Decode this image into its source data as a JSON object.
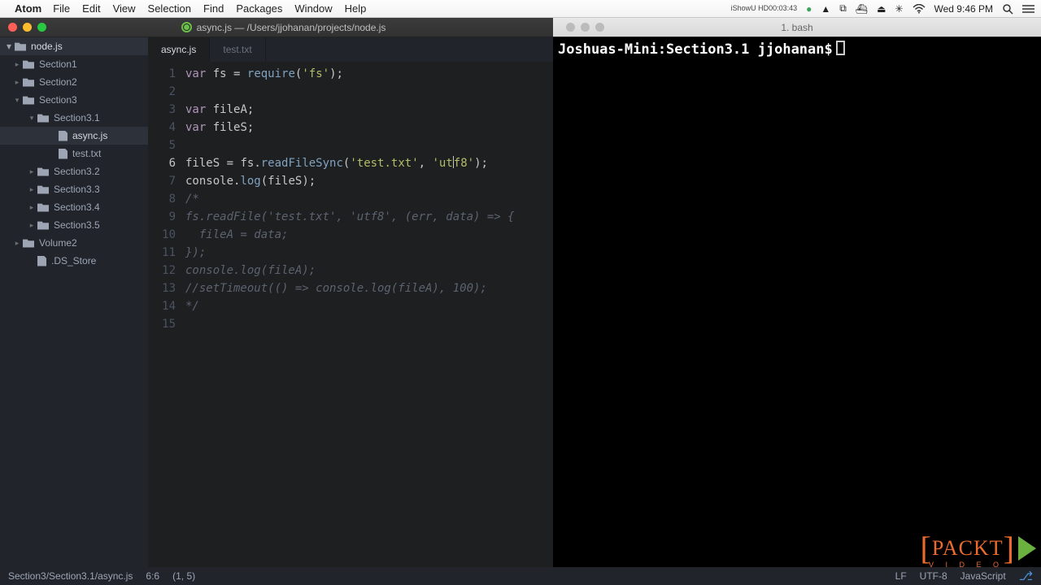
{
  "menubar": {
    "app": "Atom",
    "items": [
      "File",
      "Edit",
      "View",
      "Selection",
      "Find",
      "Packages",
      "Window",
      "Help"
    ],
    "right": {
      "ishow_top": "iShowU HD",
      "ishow_bot": "00:03:43",
      "clock": "Wed 9:46 PM"
    }
  },
  "window": {
    "atom_title": "async.js — /Users/jjohanan/projects/node.js",
    "term_title": "1. bash"
  },
  "sidebar": {
    "root": "node.js",
    "items": [
      {
        "indent": 16,
        "chev": "▸",
        "icon": "folder",
        "label": "Section1"
      },
      {
        "indent": 16,
        "chev": "▸",
        "icon": "folder",
        "label": "Section2"
      },
      {
        "indent": 16,
        "chev": "▾",
        "icon": "folder",
        "label": "Section3"
      },
      {
        "indent": 34,
        "chev": "▾",
        "icon": "folder",
        "label": "Section3.1"
      },
      {
        "indent": 60,
        "chev": "",
        "icon": "file",
        "label": "async.js",
        "selected": true
      },
      {
        "indent": 60,
        "chev": "",
        "icon": "file",
        "label": "test.txt"
      },
      {
        "indent": 34,
        "chev": "▸",
        "icon": "folder",
        "label": "Section3.2"
      },
      {
        "indent": 34,
        "chev": "▸",
        "icon": "folder",
        "label": "Section3.3"
      },
      {
        "indent": 34,
        "chev": "▸",
        "icon": "folder",
        "label": "Section3.4"
      },
      {
        "indent": 34,
        "chev": "▸",
        "icon": "folder",
        "label": "Section3.5"
      },
      {
        "indent": 16,
        "chev": "▸",
        "icon": "folder",
        "label": "Volume2"
      },
      {
        "indent": 34,
        "chev": "",
        "icon": "file",
        "label": ".DS_Store"
      }
    ]
  },
  "tabs": [
    {
      "label": "async.js",
      "active": true
    },
    {
      "label": "test.txt",
      "active": false
    }
  ],
  "code": {
    "lines": [
      {
        "n": 1,
        "html": "<span class='kw'>var</span> <span class='id'>fs</span> = <span class='fn'>require</span>(<span class='str'>'fs'</span>);"
      },
      {
        "n": 2,
        "html": ""
      },
      {
        "n": 3,
        "html": "<span class='kw'>var</span> <span class='id'>fileA</span>;"
      },
      {
        "n": 4,
        "html": "<span class='kw'>var</span> <span class='id'>fileS</span>;"
      },
      {
        "n": 5,
        "html": ""
      },
      {
        "n": 6,
        "html": "<span class='id'>fileS</span> = <span class='obj'>fs</span>.<span class='fn'>readFileSync</span>(<span class='str'>'test.txt'</span>, <span class='str'>'ut<span class=\"caret\"></span>f8'</span>);",
        "hl": true
      },
      {
        "n": 7,
        "html": "<span class='obj'>console</span>.<span class='fn'>log</span>(fileS);"
      },
      {
        "n": 8,
        "html": "<span class='cm'>/*</span>"
      },
      {
        "n": 9,
        "html": "<span class='cm'>fs.readFile('test.txt', 'utf8', (err, data) =&gt; {</span>"
      },
      {
        "n": 10,
        "html": "<span class='cm'>  fileA = data;</span>"
      },
      {
        "n": 11,
        "html": "<span class='cm'>});</span>"
      },
      {
        "n": 12,
        "html": "<span class='cm'>console.log(fileA);</span>"
      },
      {
        "n": 13,
        "html": "<span class='cm'>//setTimeout(() =&gt; console.log(fileA), 100);</span>"
      },
      {
        "n": 14,
        "html": "<span class='cm'>*/</span>"
      },
      {
        "n": 15,
        "html": ""
      }
    ]
  },
  "terminal": {
    "prompt": "Joshuas-Mini:Section3.1 jjohanan$"
  },
  "status": {
    "path": "Section3/Section3.1/async.js",
    "pos": "6:6",
    "sel": "(1, 5)",
    "eol": "LF",
    "enc": "UTF-8",
    "lang": "JavaScript"
  },
  "watermark": {
    "brand": "PACKT",
    "sub": "V I D E O"
  }
}
